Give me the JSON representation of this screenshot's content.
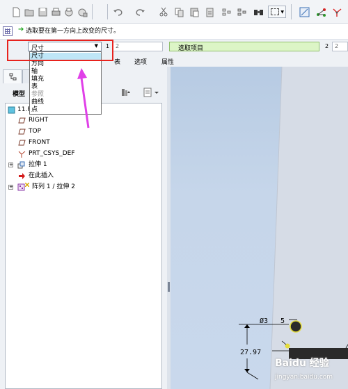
{
  "toolbar": {
    "icons": [
      "new-file-icon",
      "open-folder-icon",
      "save-icon",
      "print-icon",
      "save-copy-icon",
      "close-window-icon",
      "undo-icon",
      "redo-icon",
      "cut-icon",
      "copy-icon",
      "paste-icon",
      "paste-special-icon",
      "regenerate-icon",
      "regenerate-manager-icon",
      "find-icon",
      "select-box-icon",
      "view-orient-icon",
      "datum-icon",
      "csys-icon"
    ]
  },
  "message": {
    "text": "选取要在第一方向上改变的尺寸。"
  },
  "dashboard": {
    "type_select": {
      "selected": "尺寸"
    },
    "field1_num": "1",
    "field1_value": "2",
    "pick_field": "选取项目",
    "field2_num": "2",
    "field2_value": "2",
    "tabs": [
      "表",
      "选项",
      "属性"
    ],
    "dropdown_options": [
      "尺寸",
      "方向",
      "轴",
      "填充",
      "表",
      "参照",
      "曲线",
      "点"
    ],
    "dropdown_disabled": [
      "参照"
    ]
  },
  "model_tree": {
    "title": "模型",
    "root": "11.PRT",
    "nodes": [
      {
        "label": "RIGHT"
      },
      {
        "label": "TOP"
      },
      {
        "label": "FRONT"
      },
      {
        "label": "PRT_CSYS_DEF"
      },
      {
        "label": "拉伸 1"
      },
      {
        "label": "在此插入"
      },
      {
        "label": "阵列 1 / 拉伸 2"
      }
    ]
  },
  "graphics": {
    "dim_diameter": "Ø3",
    "dim_five": "5",
    "dim_distance": "27.97",
    "watermark": "Baidu 经验",
    "watermark_url": "jingyan.baidu.com"
  },
  "colors": {
    "annotation_red": "#e8221d",
    "arrow_magenta": "#e040e8",
    "pick_green": "#dcf5c6"
  }
}
